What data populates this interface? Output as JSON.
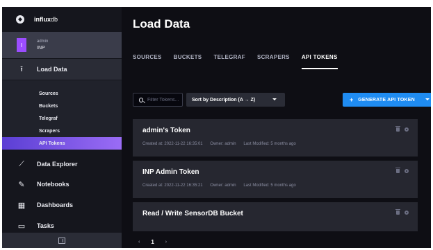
{
  "app": {
    "brand_bold": "influx",
    "brand_rest": "db",
    "user_name": "admin",
    "org_name": "INP",
    "avatar_letter": "I"
  },
  "sidebar": {
    "load_data_label": "Load Data",
    "sub_items": [
      "Sources",
      "Buckets",
      "Telegraf",
      "Scrapers",
      "API Tokens"
    ],
    "active_sub_item": "API Tokens",
    "items": [
      {
        "label": "Data Explorer",
        "icon": "chart-icon"
      },
      {
        "label": "Notebooks",
        "icon": "pen-icon"
      },
      {
        "label": "Dashboards",
        "icon": "dashboard-icon"
      },
      {
        "label": "Tasks",
        "icon": "calendar-icon"
      }
    ]
  },
  "main": {
    "title": "Load Data",
    "tabs": [
      {
        "label": "SOURCES"
      },
      {
        "label": "BUCKETS"
      },
      {
        "label": "TELEGRAF"
      },
      {
        "label": "SCRAPERS"
      },
      {
        "label": "API TOKENS",
        "active": true
      }
    ],
    "filter_placeholder": "Filter Tokens...",
    "sort_label": "Sort by Description (A → Z)",
    "generate_label": "GENERATE API TOKEN",
    "tokens": [
      {
        "name": "admin's Token",
        "created": "Created at: 2022-11-22 16:35:01",
        "owner": "Owner: admin",
        "modified": "Last Modified: 5 months ago"
      },
      {
        "name": "INP Admin Token",
        "created": "Created at: 2022-11-22 16:35:21",
        "owner": "Owner: admin",
        "modified": "Last Modified: 5 months ago"
      },
      {
        "name": "Read / Write SensorDB Bucket",
        "created": "",
        "owner": "",
        "modified": ""
      }
    ],
    "pagination": {
      "prev": "‹",
      "current": "1",
      "next": "›"
    }
  },
  "colors": {
    "accent": "#1f8cf2",
    "active_nav": "#7a5cff",
    "background": "#0e0e14",
    "card": "#262730"
  }
}
